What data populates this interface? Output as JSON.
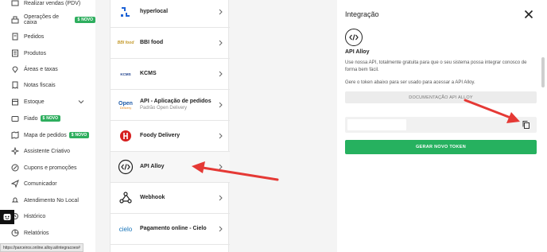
{
  "sidebar": {
    "items": [
      {
        "label": "Realizar vendas (PDV)",
        "icon": "cart-icon"
      },
      {
        "label": "Operações de caixa",
        "icon": "cash-register-icon",
        "badge": "NOVO"
      },
      {
        "label": "Pedidos",
        "icon": "orders-icon"
      },
      {
        "label": "Produtos",
        "icon": "products-icon"
      },
      {
        "label": "Áreas e taxas",
        "icon": "map-pin-icon"
      },
      {
        "label": "Notas fiscais",
        "icon": "receipt-icon"
      },
      {
        "label": "Estoque",
        "icon": "stock-icon"
      },
      {
        "label": "Fiado",
        "icon": "wallet-icon",
        "badge": "NOVO"
      },
      {
        "label": "Mapa de pedidos",
        "icon": "map-icon",
        "badge": "NOVO"
      },
      {
        "label": "Assistente Criativo",
        "icon": "sparkle-icon"
      },
      {
        "label": "Cupons e promoções",
        "icon": "coupon-icon"
      },
      {
        "label": "Comunicador",
        "icon": "send-icon"
      },
      {
        "label": "Atendimento No Local",
        "icon": "bell-icon"
      },
      {
        "label": "Histórico",
        "icon": "history-icon"
      },
      {
        "label": "Relatórios",
        "icon": "reports-icon"
      }
    ]
  },
  "status_bar": {
    "url": "https://parceiros.online.alloy.ai/integracoes#"
  },
  "integrations": {
    "items": [
      {
        "name": "hyperlocal",
        "logo": "hyperlocal-logo"
      },
      {
        "name": "BBI food",
        "logo": "bbi-food-logo",
        "logo_text": "BBI food"
      },
      {
        "name": "KCMS",
        "logo": "kcms-logo",
        "logo_text": "KCMS"
      },
      {
        "name": "API - Aplicação de pedidos",
        "subtitle": "Padrão Open Delivery",
        "logo": "open-delivery-logo",
        "logo_text": "Open",
        "logo_subtext": "Delivery"
      },
      {
        "name": "Foody Delivery",
        "logo": "foody-delivery-logo"
      },
      {
        "name": "API Alloy",
        "logo": "code-icon"
      },
      {
        "name": "Webhook",
        "logo": "webhook-icon"
      },
      {
        "name": "Pagamento online - Cielo",
        "logo": "cielo-logo",
        "logo_text": "cielo"
      }
    ]
  },
  "panel": {
    "title": "Integração",
    "api_name": "API Alloy",
    "description": "Use nossa API, totalmente gratuita para que o seu sistema possa integrar conosco de forma bem fácil.",
    "token_hint": "Gere o token abaixo para ser usado para acessar a API Alloy.",
    "doc_button": "DOCUMENTAÇÃO API ALLOY",
    "generate_button": "GERAR NOVO TOKEN",
    "token_value": ""
  },
  "colors": {
    "accent_green": "#26b15f",
    "badge_green": "#2eae5e",
    "annotation_red": "#e53935"
  }
}
